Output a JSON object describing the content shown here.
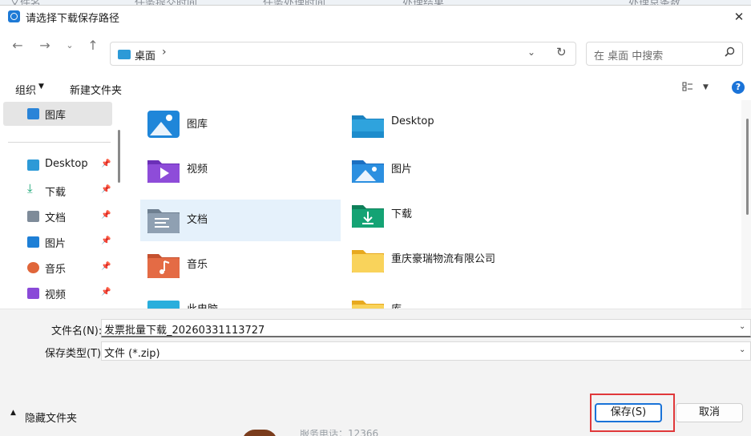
{
  "background_app": {
    "columns": [
      "文件名",
      "任务提交时间",
      "任务处理时间",
      "处理结果",
      "处理总条数"
    ],
    "footer_text": "服务电话：12366"
  },
  "dialog": {
    "title": "请选择下载保存路径",
    "address": {
      "location": "桌面",
      "separator": "›"
    },
    "search": {
      "placeholder": "在 桌面 中搜索"
    },
    "toolbar": {
      "organize": "组织",
      "new_folder": "新建文件夹"
    },
    "nav_pane": [
      {
        "label": "图库",
        "icon": "gallery-icon",
        "color": "#2a84d8",
        "selected": true,
        "pinned": false
      },
      {
        "label": "Desktop",
        "icon": "desktop-icon",
        "color": "#2d9ad7",
        "selected": false,
        "pinned": true
      },
      {
        "label": "下载",
        "icon": "download-icon",
        "color": "#12a371",
        "selected": false,
        "pinned": true
      },
      {
        "label": "文档",
        "icon": "document-icon",
        "color": "#7e8b99",
        "selected": false,
        "pinned": true
      },
      {
        "label": "图片",
        "icon": "pictures-icon",
        "color": "#1e7fd6",
        "selected": false,
        "pinned": true
      },
      {
        "label": "音乐",
        "icon": "music-icon",
        "color": "#e0663a",
        "selected": false,
        "pinned": true
      },
      {
        "label": "视频",
        "icon": "video-icon",
        "color": "#8a4ad8",
        "selected": false,
        "pinned": true
      }
    ],
    "items": [
      {
        "label": "图库",
        "icon": "gallery-folder-icon",
        "color": "#1f86d9",
        "selected": false
      },
      {
        "label": "Desktop",
        "icon": "desktop-folder-icon",
        "color": "#2fa3dd",
        "selected": false
      },
      {
        "label": "视频",
        "icon": "video-folder-icon",
        "color": "#8e4cd9",
        "selected": false
      },
      {
        "label": "图片",
        "icon": "pictures-folder-icon",
        "color": "#2b8fe0",
        "selected": false
      },
      {
        "label": "文档",
        "icon": "documents-folder-icon",
        "color": "#8fa0b2",
        "selected": true
      },
      {
        "label": "下载",
        "icon": "downloads-folder-icon",
        "color": "#14a374",
        "selected": false
      },
      {
        "label": "音乐",
        "icon": "music-folder-icon",
        "color": "#e46b45",
        "selected": false
      },
      {
        "label": "重庆豪瑞物流有限公司",
        "icon": "folder-icon",
        "color": "#f5c33b",
        "selected": false
      },
      {
        "label": "此电脑",
        "icon": "this-pc-icon",
        "color": "#2aaedc",
        "selected": false
      },
      {
        "label": "库",
        "icon": "libraries-folder-icon",
        "color": "#f5c33b",
        "selected": false
      }
    ],
    "file_name": {
      "label": "文件名(N):",
      "value": "发票批量下载_20260331113727"
    },
    "file_type": {
      "label": "保存类型(T):",
      "value": "文件 (*.zip)"
    },
    "hide_folders": "隐藏文件夹",
    "save_button": "保存(S)",
    "cancel_button": "取消"
  }
}
